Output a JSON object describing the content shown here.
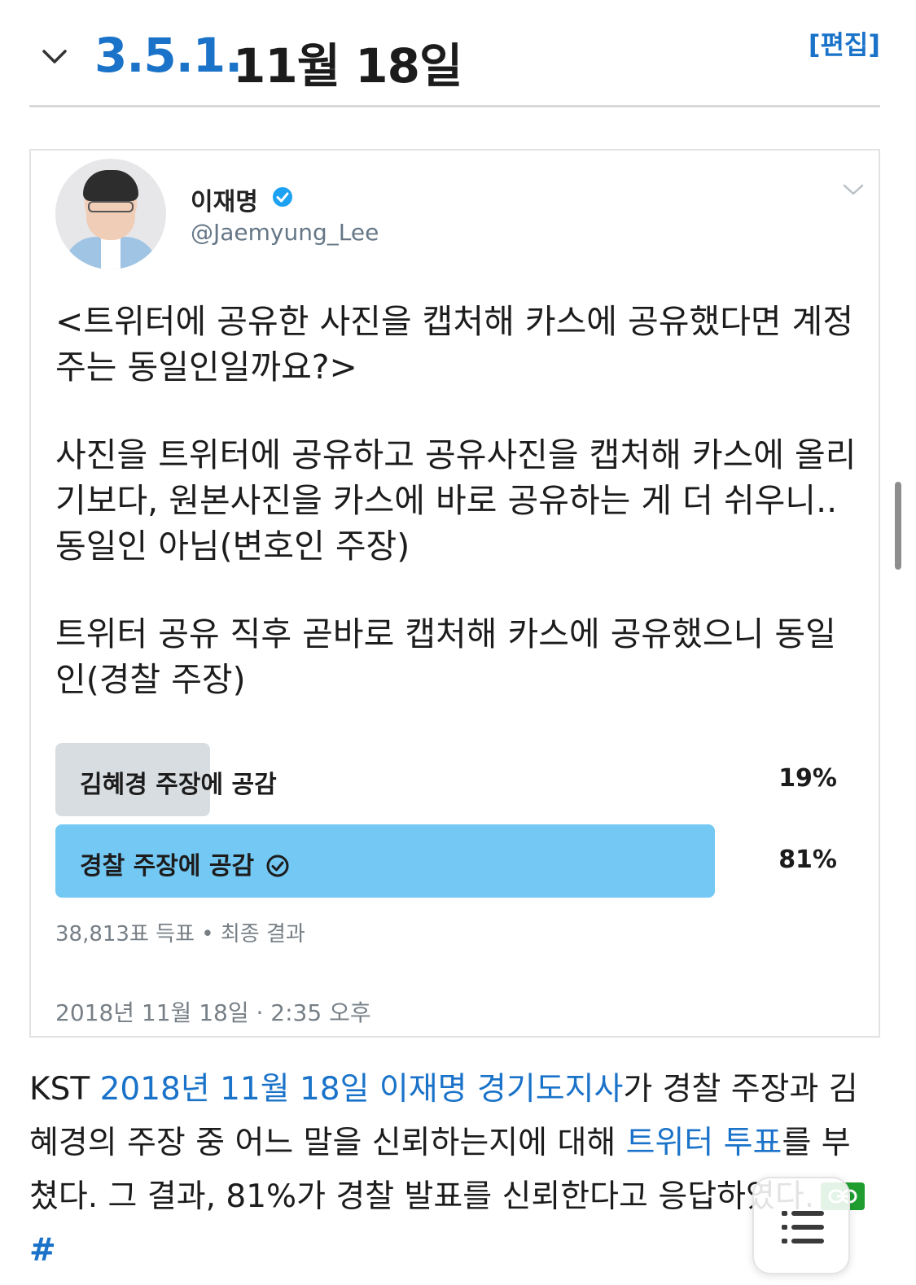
{
  "section": {
    "number": "3.5.1.",
    "title": "11월 18일",
    "edit_label": "[편집]"
  },
  "tweet": {
    "display_name": "이재명",
    "handle": "@Jaemyung_Lee",
    "paragraphs": [
      "<트위터에 공유한 사진을 캡처해 카스에 공유했다면 계정주는 동일인일까요?>",
      "사진을 트위터에 공유하고 공유사진을 캡처해 카스에 올리기보다, 원본사진을 카스에 바로 공유하는 게 더 쉬우니..동일인 아님(변호인 주장)",
      "트위터 공유 직후 곧바로 캡처해 카스에 공유했으니 동일인(경찰 주장)"
    ],
    "poll": {
      "options": [
        {
          "label": "김혜경 주장에 공감",
          "percent": "19%",
          "value": 19,
          "winner": false
        },
        {
          "label": "경찰 주장에 공감",
          "percent": "81%",
          "value": 81,
          "winner": true
        }
      ],
      "meta": "38,813표 득표 • 최종 결과"
    },
    "timestamp": "2018년 11월 18일 · 2:35 오후"
  },
  "description": {
    "prefix": "KST ",
    "link_date": "2018년 11월 18일",
    "link_person": "이재명 경기도지사",
    "mid": "가 경찰 주장과 김혜경의 주장 중 어느 말을 신뢰하는지에 대해 ",
    "link_poll": "트위터 투표",
    "suffix": "를 부쳤다. 그 결과, 81%가 경찰 발표를 신뢰한다고 응답하였다.",
    "hash": "#"
  },
  "colors": {
    "link": "#1a73c9",
    "poll_winner": "#74c8f4",
    "poll_other": "#d8dde1",
    "anchor_green": "#1f9e2f"
  }
}
